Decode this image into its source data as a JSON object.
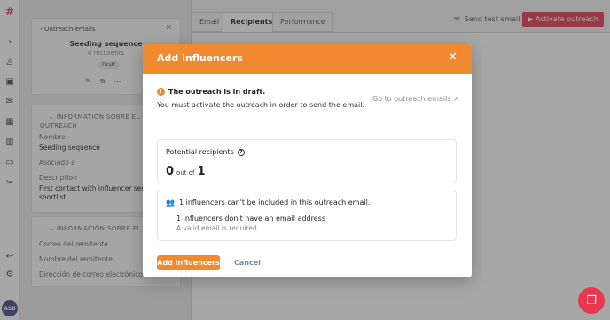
{
  "rail": {
    "avatar": "ASB"
  },
  "left_panel": {
    "back_label": "Outreach emails",
    "sequence_name": "Seeding sequence",
    "recipients": "0 recipients",
    "status_badge": "Draft",
    "section1_title": "INFORMATION SOBRE EL OUTREACH",
    "name_label": "Nombre",
    "name_value": "Seeding sequence",
    "assoc_label": "Asociado a",
    "desc_label": "Description",
    "desc_value_line1": "First contact with influencer seedi",
    "desc_value_line2": "shortlist",
    "section2_title": "INFORMACIÓN SOBRE EL OU",
    "sender_email_label": "Correo del remitente",
    "sender_name_label": "Nombre del remitente",
    "sender_address_label": "Dirección de correo electrónico de"
  },
  "tabs": [
    "Email",
    "Recipients",
    "Performance"
  ],
  "header": {
    "send_test": "Send test email",
    "activate": "Activate outreach"
  },
  "modal": {
    "title": "Add influencers",
    "warning_title": "The outreach is in draft.",
    "warning_sub": "You must activate the outreach in order to send the email.",
    "goto_link": "Go to outreach emails",
    "potential_label": "Potential recipients",
    "count_current": "0",
    "count_out_of": "out of",
    "count_total": "1",
    "excluded_text": "1 influencers can't be included in this outreach email.",
    "reason_title": "1 influencers don't have an email address",
    "reason_sub": "A valid email is required",
    "add_button": "Add influencers",
    "cancel_button": "Cancel"
  },
  "colors": {
    "accent_orange": "#f0892f",
    "brand_red": "#e8384f",
    "link_grey_blue": "#7a8aa6"
  },
  "icons": [
    "hashtag-logo-icon",
    "chevron-right-icon",
    "users-icon",
    "contacts-icon",
    "mail-icon",
    "calendar-icon",
    "chart-icon",
    "wallet-icon",
    "tools-icon",
    "arrow-icon",
    "settings-icon",
    "chat-icon",
    "external-link-icon",
    "question-icon",
    "warning-icon",
    "close-icon"
  ]
}
